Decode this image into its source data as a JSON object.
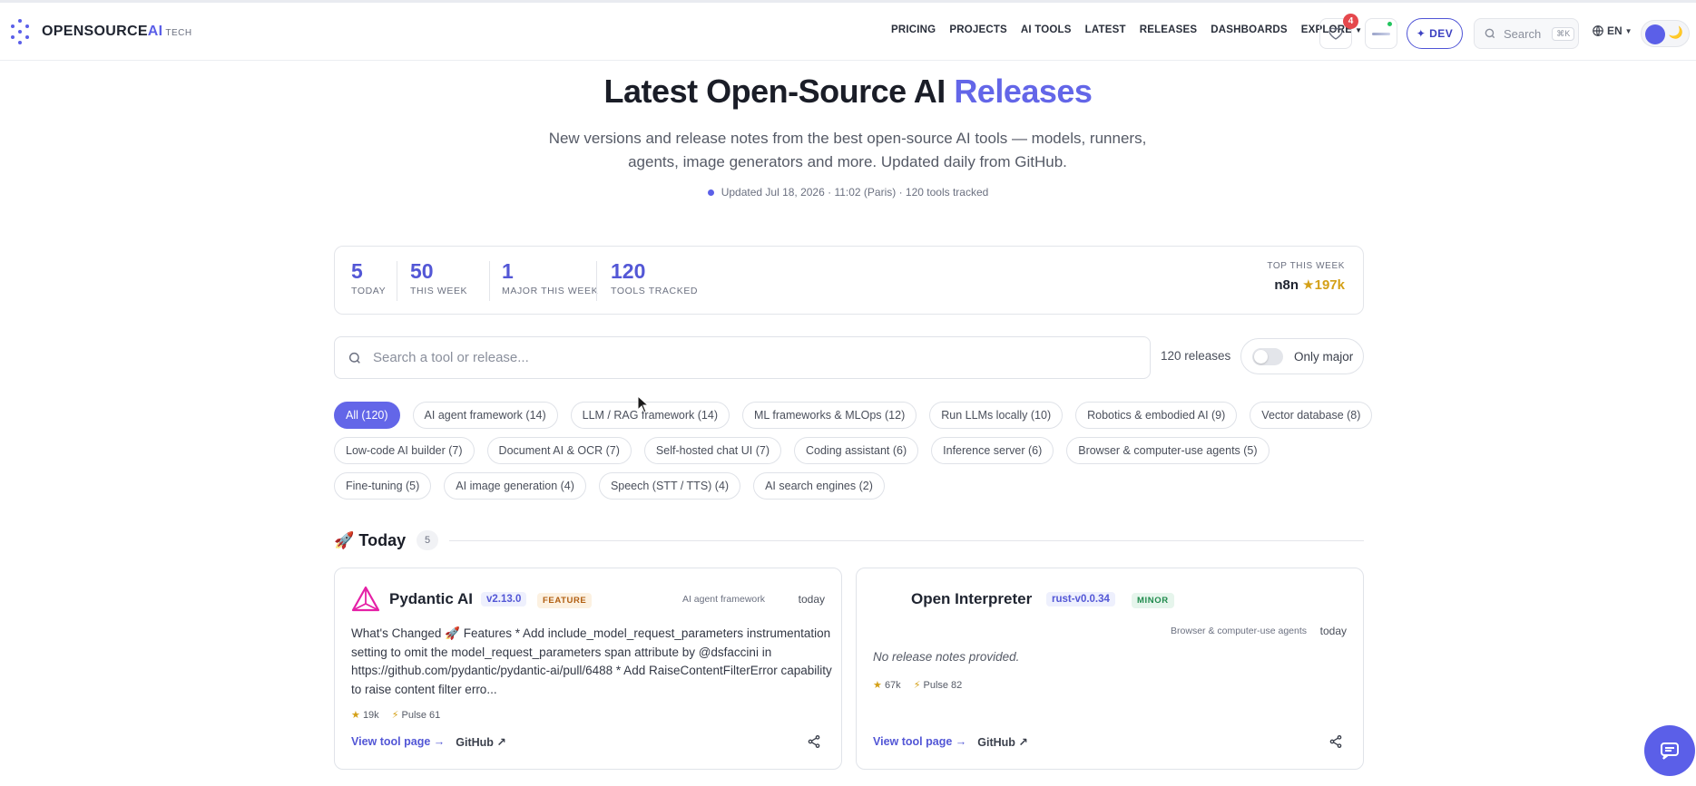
{
  "brand": {
    "name_prefix": "OPENSOURCE",
    "name_accent": "AI",
    "name_suffix": "TECH"
  },
  "nav": {
    "links": [
      "PRICING",
      "PROJECTS",
      "AI TOOLS",
      "LATEST",
      "RELEASES",
      "DASHBOARDS",
      "EXPLORE"
    ],
    "favorites_count": "4",
    "dev_label": "✦ DEV",
    "search_label": "Search",
    "search_shortcut": "⌘K",
    "language": "EN"
  },
  "hero": {
    "title_main": "Latest Open-Source AI",
    "title_highlight": "Releases",
    "subtitle": "New versions and release notes from the best open-source AI tools — models, runners, agents, image generators and more. Updated daily from GitHub.",
    "updated": "Updated Jul 18, 2026 · 11:02 (Paris) · 120 tools tracked"
  },
  "stats": [
    {
      "value": "5",
      "label": "TODAY"
    },
    {
      "value": "50",
      "label": "THIS WEEK"
    },
    {
      "value": "1",
      "label": "MAJOR THIS WEEK"
    },
    {
      "value": "120",
      "label": "TOOLS TRACKED"
    }
  ],
  "top_week": {
    "label": "TOP THIS WEEK",
    "name": "n8n",
    "stars": "★197k"
  },
  "search": {
    "placeholder": "Search a tool or release...",
    "count": "120 releases",
    "toggle_label": "Only major",
    "toggle_on": false
  },
  "chip_rows": [
    [
      "All (120)",
      "AI agent framework (14)",
      "LLM / RAG framework (14)",
      "ML frameworks & MLOps (12)",
      "Run LLMs locally (10)",
      "Robotics & embodied AI (9)",
      "Vector database (8)"
    ],
    [
      "Low-code AI builder (7)",
      "Document AI & OCR (7)",
      "Self-hosted chat UI (7)",
      "Coding assistant (6)",
      "Inference server (6)",
      "Browser & computer-use agents (5)"
    ],
    [
      "Fine-tuning (5)",
      "AI image generation (4)",
      "Speech (STT / TTS) (4)",
      "AI search engines (2)"
    ]
  ],
  "section": {
    "title": "🚀 Today",
    "count": "5"
  },
  "cards": [
    {
      "name": "Pydantic AI",
      "version": "v2.13.0",
      "badge": "FEATURE",
      "category": "AI agent framework",
      "when": "today",
      "notes": "What's Changed 🚀 Features * Add include_model_request_parameters instrumentation setting to omit the model_request_parameters span attribute by @dsfaccini in https://github.com/pydantic/pydantic-ai/pull/6488 * Add RaiseContentFilterError capability to raise content filter erro...",
      "stars": "19k",
      "pulse": "Pulse 61",
      "link_tool": "View tool page →",
      "link_github": "GitHub ↗"
    },
    {
      "name": "Open Interpreter",
      "version": "rust-v0.0.34",
      "badge": "MINOR",
      "category": "Browser & computer-use agents",
      "when": "today",
      "notes": "No release notes provided.",
      "stars": "67k",
      "pulse": "Pulse 82",
      "link_tool": "View tool page →",
      "link_github": "GitHub ↗"
    }
  ]
}
